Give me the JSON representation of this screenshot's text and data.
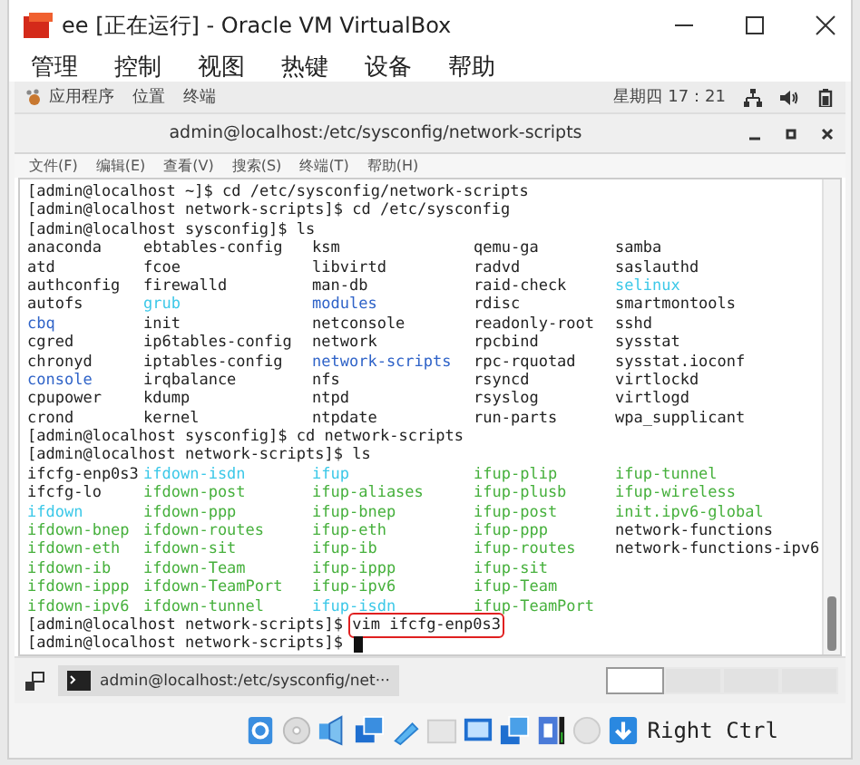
{
  "window": {
    "title": "ee [正在运行] - Oracle VM VirtualBox"
  },
  "menu": [
    "管理",
    "控制",
    "视图",
    "热键",
    "设备",
    "帮助"
  ],
  "top_bar": {
    "items": [
      "应用程序",
      "位置",
      "终端"
    ],
    "clock": "星期四 17：21"
  },
  "terminal": {
    "title": "admin@localhost:/etc/sysconfig/network-scripts",
    "menu": [
      "文件(F)",
      "编辑(E)",
      "查看(V)",
      "搜索(S)",
      "终端(T)",
      "帮助(H)"
    ],
    "lines": [
      {
        "kind": "prompt",
        "prompt": "[admin@localhost ~]$",
        "command": "cd /etc/sysconfig/network-scripts"
      },
      {
        "kind": "prompt",
        "prompt": "[admin@localhost network-scripts]$",
        "command": "cd /etc/sysconfig"
      },
      {
        "kind": "prompt",
        "prompt": "[admin@localhost sysconfig]$",
        "command": "ls"
      },
      {
        "kind": "files",
        "cells": [
          {
            "text": "anaconda",
            "color": "#222222"
          },
          {
            "text": "ebtables-config",
            "color": "#222222"
          },
          {
            "text": "ksm",
            "color": "#222222"
          },
          {
            "text": "qemu-ga",
            "color": "#222222"
          },
          {
            "text": "samba",
            "color": "#222222"
          }
        ]
      },
      {
        "kind": "files",
        "cells": [
          {
            "text": "atd",
            "color": "#222222"
          },
          {
            "text": "fcoe",
            "color": "#222222"
          },
          {
            "text": "libvirtd",
            "color": "#222222"
          },
          {
            "text": "radvd",
            "color": "#222222"
          },
          {
            "text": "saslauthd",
            "color": "#222222"
          }
        ]
      },
      {
        "kind": "files",
        "cells": [
          {
            "text": "authconfig",
            "color": "#222222"
          },
          {
            "text": "firewalld",
            "color": "#222222"
          },
          {
            "text": "man-db",
            "color": "#222222"
          },
          {
            "text": "raid-check",
            "color": "#222222"
          },
          {
            "text": "selinux",
            "color": "#3cc8e8"
          }
        ]
      },
      {
        "kind": "files",
        "cells": [
          {
            "text": "autofs",
            "color": "#222222"
          },
          {
            "text": "grub",
            "color": "#3cc8e8"
          },
          {
            "text": "modules",
            "color": "#2f63c8"
          },
          {
            "text": "rdisc",
            "color": "#222222"
          },
          {
            "text": "smartmontools",
            "color": "#222222"
          }
        ]
      },
      {
        "kind": "files",
        "cells": [
          {
            "text": "cbq",
            "color": "#2f63c8"
          },
          {
            "text": "init",
            "color": "#222222"
          },
          {
            "text": "netconsole",
            "color": "#222222"
          },
          {
            "text": "readonly-root",
            "color": "#222222"
          },
          {
            "text": "sshd",
            "color": "#222222"
          }
        ]
      },
      {
        "kind": "files",
        "cells": [
          {
            "text": "cgred",
            "color": "#222222"
          },
          {
            "text": "ip6tables-config",
            "color": "#222222"
          },
          {
            "text": "network",
            "color": "#222222"
          },
          {
            "text": "rpcbind",
            "color": "#222222"
          },
          {
            "text": "sysstat",
            "color": "#222222"
          }
        ]
      },
      {
        "kind": "files",
        "cells": [
          {
            "text": "chronyd",
            "color": "#222222"
          },
          {
            "text": "iptables-config",
            "color": "#222222"
          },
          {
            "text": "network-scripts",
            "color": "#2f63c8"
          },
          {
            "text": "rpc-rquotad",
            "color": "#222222"
          },
          {
            "text": "sysstat.ioconf",
            "color": "#222222"
          }
        ]
      },
      {
        "kind": "files",
        "cells": [
          {
            "text": "console",
            "color": "#2f63c8"
          },
          {
            "text": "irqbalance",
            "color": "#222222"
          },
          {
            "text": "nfs",
            "color": "#222222"
          },
          {
            "text": "rsyncd",
            "color": "#222222"
          },
          {
            "text": "virtlockd",
            "color": "#222222"
          }
        ]
      },
      {
        "kind": "files",
        "cells": [
          {
            "text": "cpupower",
            "color": "#222222"
          },
          {
            "text": "kdump",
            "color": "#222222"
          },
          {
            "text": "ntpd",
            "color": "#222222"
          },
          {
            "text": "rsyslog",
            "color": "#222222"
          },
          {
            "text": "virtlogd",
            "color": "#222222"
          }
        ]
      },
      {
        "kind": "files",
        "cells": [
          {
            "text": "crond",
            "color": "#222222"
          },
          {
            "text": "kernel",
            "color": "#222222"
          },
          {
            "text": "ntpdate",
            "color": "#222222"
          },
          {
            "text": "run-parts",
            "color": "#222222"
          },
          {
            "text": "wpa_supplicant",
            "color": "#222222"
          }
        ]
      },
      {
        "kind": "prompt",
        "prompt": "[admin@localhost sysconfig]$",
        "command": "cd network-scripts"
      },
      {
        "kind": "prompt",
        "prompt": "[admin@localhost network-scripts]$",
        "command": "ls"
      },
      {
        "kind": "files",
        "cells": [
          {
            "text": "ifcfg-enp0s3",
            "color": "#222222"
          },
          {
            "text": "ifdown-isdn",
            "color": "#3cc8e8"
          },
          {
            "text": "ifup",
            "color": "#3cc8e8"
          },
          {
            "text": "ifup-plip",
            "color": "#46b03c"
          },
          {
            "text": "ifup-tunnel",
            "color": "#46b03c"
          }
        ]
      },
      {
        "kind": "files",
        "cells": [
          {
            "text": "ifcfg-lo",
            "color": "#222222"
          },
          {
            "text": "ifdown-post",
            "color": "#46b03c"
          },
          {
            "text": "ifup-aliases",
            "color": "#46b03c"
          },
          {
            "text": "ifup-plusb",
            "color": "#46b03c"
          },
          {
            "text": "ifup-wireless",
            "color": "#46b03c"
          }
        ]
      },
      {
        "kind": "files",
        "cells": [
          {
            "text": "ifdown",
            "color": "#3cc8e8"
          },
          {
            "text": "ifdown-ppp",
            "color": "#46b03c"
          },
          {
            "text": "ifup-bnep",
            "color": "#46b03c"
          },
          {
            "text": "ifup-post",
            "color": "#46b03c"
          },
          {
            "text": "init.ipv6-global",
            "color": "#46b03c"
          }
        ]
      },
      {
        "kind": "files",
        "cells": [
          {
            "text": "ifdown-bnep",
            "color": "#46b03c"
          },
          {
            "text": "ifdown-routes",
            "color": "#46b03c"
          },
          {
            "text": "ifup-eth",
            "color": "#46b03c"
          },
          {
            "text": "ifup-ppp",
            "color": "#46b03c"
          },
          {
            "text": "network-functions",
            "color": "#222222"
          }
        ]
      },
      {
        "kind": "files",
        "cells": [
          {
            "text": "ifdown-eth",
            "color": "#46b03c"
          },
          {
            "text": "ifdown-sit",
            "color": "#46b03c"
          },
          {
            "text": "ifup-ib",
            "color": "#46b03c"
          },
          {
            "text": "ifup-routes",
            "color": "#46b03c"
          },
          {
            "text": "network-functions-ipv6",
            "color": "#222222"
          }
        ]
      },
      {
        "kind": "files",
        "cells": [
          {
            "text": "ifdown-ib",
            "color": "#46b03c"
          },
          {
            "text": "ifdown-Team",
            "color": "#46b03c"
          },
          {
            "text": "ifup-ippp",
            "color": "#46b03c"
          },
          {
            "text": "ifup-sit",
            "color": "#46b03c"
          }
        ]
      },
      {
        "kind": "files",
        "cells": [
          {
            "text": "ifdown-ippp",
            "color": "#46b03c"
          },
          {
            "text": "ifdown-TeamPort",
            "color": "#46b03c"
          },
          {
            "text": "ifup-ipv6",
            "color": "#46b03c"
          },
          {
            "text": "ifup-Team",
            "color": "#46b03c"
          }
        ]
      },
      {
        "kind": "files",
        "cells": [
          {
            "text": "ifdown-ipv6",
            "color": "#46b03c"
          },
          {
            "text": "ifdown-tunnel",
            "color": "#46b03c"
          },
          {
            "text": "ifup-isdn",
            "color": "#3cc8e8"
          },
          {
            "text": "ifup-TeamPort",
            "color": "#46b03c"
          }
        ]
      },
      {
        "kind": "prompt",
        "prompt": "[admin@localhost network-scripts]$",
        "command": "vim ifcfg-enp0s3",
        "highlighted": true
      },
      {
        "kind": "prompt",
        "prompt": "[admin@localhost network-scripts]$",
        "cursor": true
      }
    ]
  },
  "taskbar": {
    "task": "admin@localhost:/etc/sysconfig/net···",
    "workspaces": [
      {
        "selected": true
      },
      {
        "selected": false
      },
      {
        "selected": false
      },
      {
        "selected": false
      }
    ]
  },
  "status_bar": {
    "host_key": "Right Ctrl"
  }
}
